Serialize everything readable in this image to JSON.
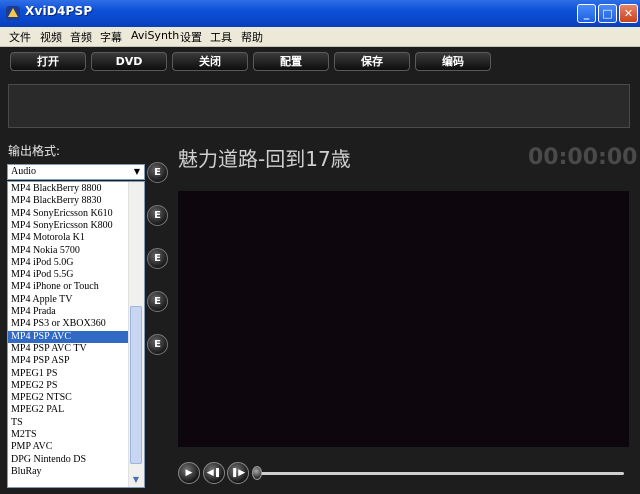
{
  "window": {
    "title": "XviD4PSP",
    "minimize": "_",
    "maximize": "□",
    "close": "✕"
  },
  "menu": [
    "文件",
    "视频",
    "音频",
    "字幕",
    "AviSynth",
    "设置",
    "工具",
    "帮助"
  ],
  "toolbar": [
    "打开",
    "DVD",
    "关闭",
    "配置",
    "保存",
    "编码"
  ],
  "format": {
    "label": "输出格式:",
    "selected": "Audio",
    "items": [
      "MP4 BlackBerry 8800",
      "MP4 BlackBerry 8830",
      "MP4 SonyEricsson K610",
      "MP4 SonyEricsson K800",
      "MP4 Motorola K1",
      "MP4 Nokia 5700",
      "MP4 iPod 5.0G",
      "MP4 iPod 5.5G",
      "MP4 iPhone or Touch",
      "MP4 Apple TV",
      "MP4 Prada",
      "MP4 PS3 or XBOX360",
      "MP4 PSP AVC",
      "MP4 PSP AVC TV",
      "MP4 PSP ASP",
      "MPEG1 PS",
      "MPEG2 PS",
      "MPEG2 NTSC",
      "MPEG2 PAL",
      "TS",
      "M2TS",
      "PMP AVC",
      "DPG Nintendo DS",
      "BluRay"
    ],
    "highlighted_index": 12
  },
  "edit_buttons": [
    "E",
    "E",
    "E",
    "E",
    "E"
  ],
  "video": {
    "title": "魅力道路-回到17歳",
    "timecode": "00:00:00"
  },
  "controls": {
    "play": "▶",
    "prev": "◀❚",
    "next": "❚▶"
  },
  "colors": {
    "selection": "#316ac5",
    "title_bar": "#0a4fd6"
  },
  "icons": {
    "app": "app-logo-icon",
    "dropdown": "chevron-down-icon"
  }
}
